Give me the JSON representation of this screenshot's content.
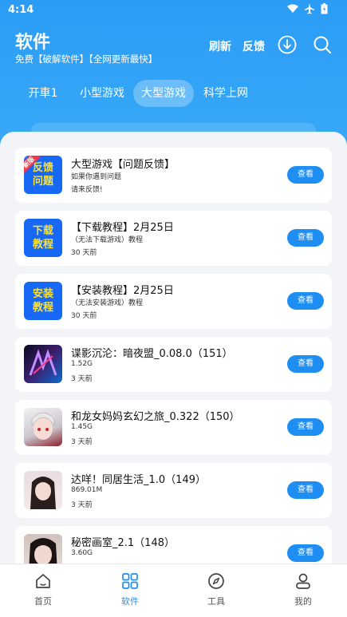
{
  "status_bar": {
    "time": "4:14"
  },
  "header": {
    "title": "软件",
    "subtitle": "免费【破解软件】【全网更新最快】",
    "refresh_label": "刷新",
    "feedback_label": "反馈",
    "download_icon": "download-icon",
    "search_icon": "search-icon"
  },
  "tabs": [
    {
      "label": "开車1"
    },
    {
      "label": "小型游戏"
    },
    {
      "label": "大型游戏"
    },
    {
      "label": "科学上网"
    }
  ],
  "active_tab": "大型游戏",
  "items": [
    {
      "title": "大型游戏【问题反馈】",
      "line1": "如果你遇到问题",
      "line2": "请来反馈!",
      "thumb_text": "反馈问题",
      "ribbon": "新版",
      "button": "查看"
    },
    {
      "title": "【下载教程】2月25日",
      "line1": "（无法下载游戏）教程",
      "line2": "30 天前",
      "thumb_text": "下载教程",
      "button": "查看"
    },
    {
      "title": "【安装教程】2月25日",
      "line1": "（无法安装游戏）教程",
      "line2": "30 天前",
      "thumb_text": "安装教程",
      "button": "查看"
    },
    {
      "title": "谍影沉沦：暗夜盟_0.08.0（151）",
      "line1": "1.52G",
      "line2": "3 天前",
      "button": "查看"
    },
    {
      "title": "和龙女妈妈玄幻之旅_0.322（150）",
      "line1": "1.45G",
      "line2": "3 天前",
      "button": "查看"
    },
    {
      "title": "达咩！同居生活_1.0（149）",
      "line1": "869.01M",
      "line2": "3 天前",
      "button": "查看"
    },
    {
      "title": "秘密画室_2.1（148）",
      "line1": "3.60G",
      "line2": "",
      "button": "查看"
    }
  ],
  "bottom_nav": [
    {
      "label": "首页",
      "icon": "home-icon"
    },
    {
      "label": "软件",
      "icon": "grid-icon"
    },
    {
      "label": "工具",
      "icon": "compass-icon"
    },
    {
      "label": "我的",
      "icon": "user-icon"
    }
  ],
  "colors": {
    "primary": "#2b9cf5",
    "button": "#1f8ef3",
    "thumb_blue": "#1668f5",
    "thumb_text": "#ffe22e"
  }
}
